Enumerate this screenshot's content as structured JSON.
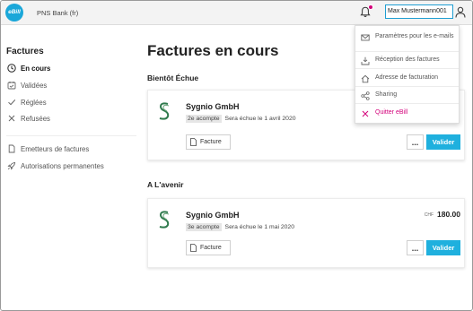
{
  "header": {
    "logo_text": "eBill",
    "bank_name": "PNS Bank (fr)",
    "user_name": "Max Mustermann001",
    "notification_icon": "bell-icon",
    "user_icon": "user-icon"
  },
  "sidebar": {
    "title": "Factures",
    "items": [
      {
        "label": "En cours",
        "icon": "clock-icon",
        "active": true
      },
      {
        "label": "Validées",
        "icon": "calendar-check-icon",
        "active": false
      },
      {
        "label": "Réglées",
        "icon": "check-icon",
        "active": false
      },
      {
        "label": "Refusées",
        "icon": "cross-icon",
        "active": false
      }
    ],
    "secondary_items": [
      {
        "label": "Emetteurs de factures",
        "icon": "document-icon"
      },
      {
        "label": "Autorisations permanentes",
        "icon": "rocket-icon"
      }
    ]
  },
  "main": {
    "title": "Factures en cours",
    "sections": [
      {
        "title": "Bientôt Échue",
        "card": {
          "company": "Sygnio GmbH",
          "tag": "2e acompte",
          "due": "Sera échue le 1 avril 2020",
          "currency": "",
          "amount": "",
          "facture_label": "Facture",
          "more_label": "...",
          "valider_label": "Valider"
        }
      },
      {
        "title": "A L'avenir",
        "card": {
          "company": "Sygnio GmbH",
          "tag": "3e acompte",
          "due": "Sera échue le 1 mai 2020",
          "currency": "CHF",
          "amount": "180.00",
          "facture_label": "Facture",
          "more_label": "...",
          "valider_label": "Valider"
        }
      }
    ]
  },
  "dropdown": {
    "items": [
      {
        "label": "Paramètres pour les e-mails",
        "icon": "mail-icon"
      },
      {
        "label": "Réception des factures",
        "icon": "inbox-icon"
      },
      {
        "label": "Adresse de facturation",
        "icon": "home-icon"
      },
      {
        "label": "Sharing",
        "icon": "share-icon"
      },
      {
        "label": "Quitter eBill",
        "icon": "close-icon"
      }
    ]
  },
  "colors": {
    "accent": "#1fb0de",
    "brand": "#1aa7d9",
    "danger": "#d3007a"
  }
}
